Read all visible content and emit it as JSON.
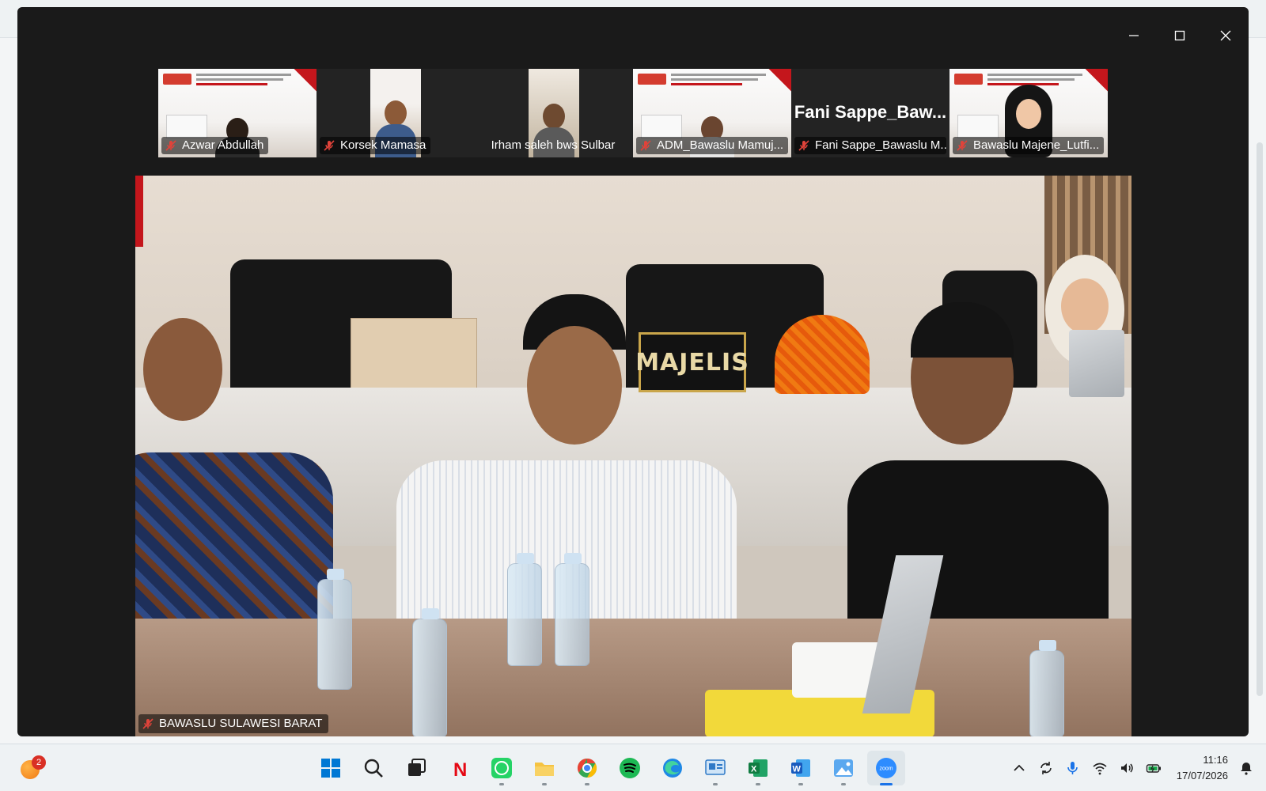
{
  "window": {
    "controls": {
      "minimize": "minimize-icon",
      "maximize": "maximize-icon",
      "close": "close-icon"
    }
  },
  "gallery": [
    {
      "name": "Azwar Abdullah",
      "muted": true
    },
    {
      "name": "Korsek Mamasa",
      "muted": true
    },
    {
      "name": "Irham saleh bws Sulbar",
      "muted": false
    },
    {
      "name": "ADM_Bawaslu Mamuj...",
      "muted": true
    },
    {
      "name": "Fani Sappe_Bawaslu M...",
      "muted": true,
      "display_name": "Fani  Sappe_Baw..."
    },
    {
      "name": "Bawaslu Majene_Lutfi...",
      "muted": true
    }
  ],
  "main_video": {
    "name": "BAWASLU SULAWESI BARAT",
    "muted": true,
    "nameplate_text": "MAJELIS"
  },
  "taskbar": {
    "widget_badge": "2",
    "apps": [
      {
        "name": "start",
        "icon": "windows-icon"
      },
      {
        "name": "search",
        "icon": "search-icon"
      },
      {
        "name": "task-view",
        "icon": "task-view-icon"
      },
      {
        "name": "netflix",
        "icon": "netflix-icon"
      },
      {
        "name": "whatsapp",
        "icon": "whatsapp-icon"
      },
      {
        "name": "file-explorer",
        "icon": "folder-icon"
      },
      {
        "name": "chrome",
        "icon": "chrome-icon"
      },
      {
        "name": "spotify",
        "icon": "spotify-icon"
      },
      {
        "name": "edge",
        "icon": "edge-icon"
      },
      {
        "name": "control-panel",
        "icon": "control-panel-icon"
      },
      {
        "name": "excel",
        "icon": "excel-icon"
      },
      {
        "name": "word",
        "icon": "word-icon"
      },
      {
        "name": "photos",
        "icon": "photos-icon"
      },
      {
        "name": "zoom",
        "icon": "zoom-icon",
        "active": true
      }
    ],
    "clock_time": "11:16",
    "clock_date": "17/07/2026",
    "zoom_label": "zoom",
    "netflix_letter": "N",
    "excel_letter": "X",
    "word_letter": "W"
  },
  "colors": {
    "window_bg": "#1a1a1a",
    "muted_red": "#e0433a",
    "accent": "#1a73e8"
  }
}
